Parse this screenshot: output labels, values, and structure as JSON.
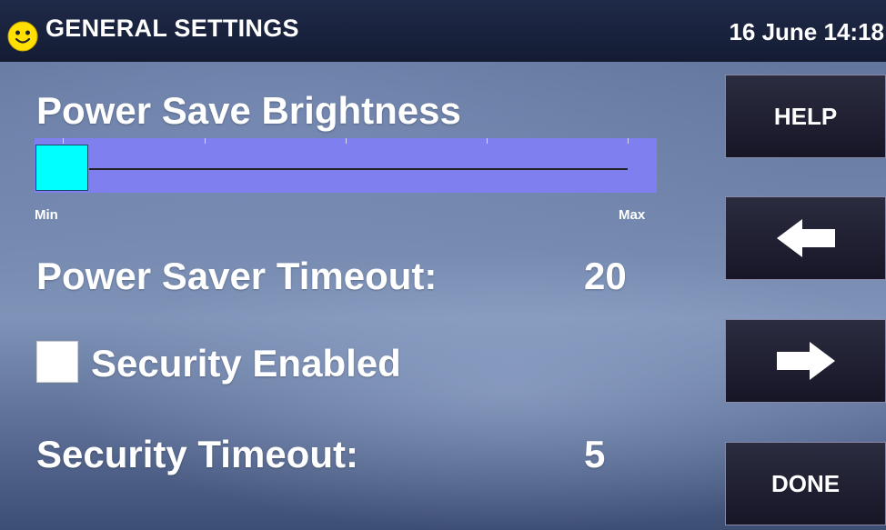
{
  "header": {
    "title": "GENERAL SETTINGS",
    "datetime": "16 June 14:18",
    "status_icon": "smiley-icon"
  },
  "settings": {
    "brightness": {
      "label": "Power Save Brightness",
      "min_label": "Min",
      "max_label": "Max",
      "value_fraction": 0.0
    },
    "power_saver_timeout": {
      "label": "Power Saver Timeout:",
      "value": "20"
    },
    "security_enabled": {
      "label": "Security Enabled",
      "checked": false
    },
    "security_timeout": {
      "label": "Security Timeout:",
      "value": "5"
    }
  },
  "sidebar": {
    "help_label": "HELP",
    "back_icon": "arrow-left-icon",
    "forward_icon": "arrow-right-icon",
    "done_label": "DONE"
  },
  "colors": {
    "slider_bg": "#7f7ff0",
    "slider_thumb": "#00ffff",
    "header_bg": "#1a2440"
  }
}
